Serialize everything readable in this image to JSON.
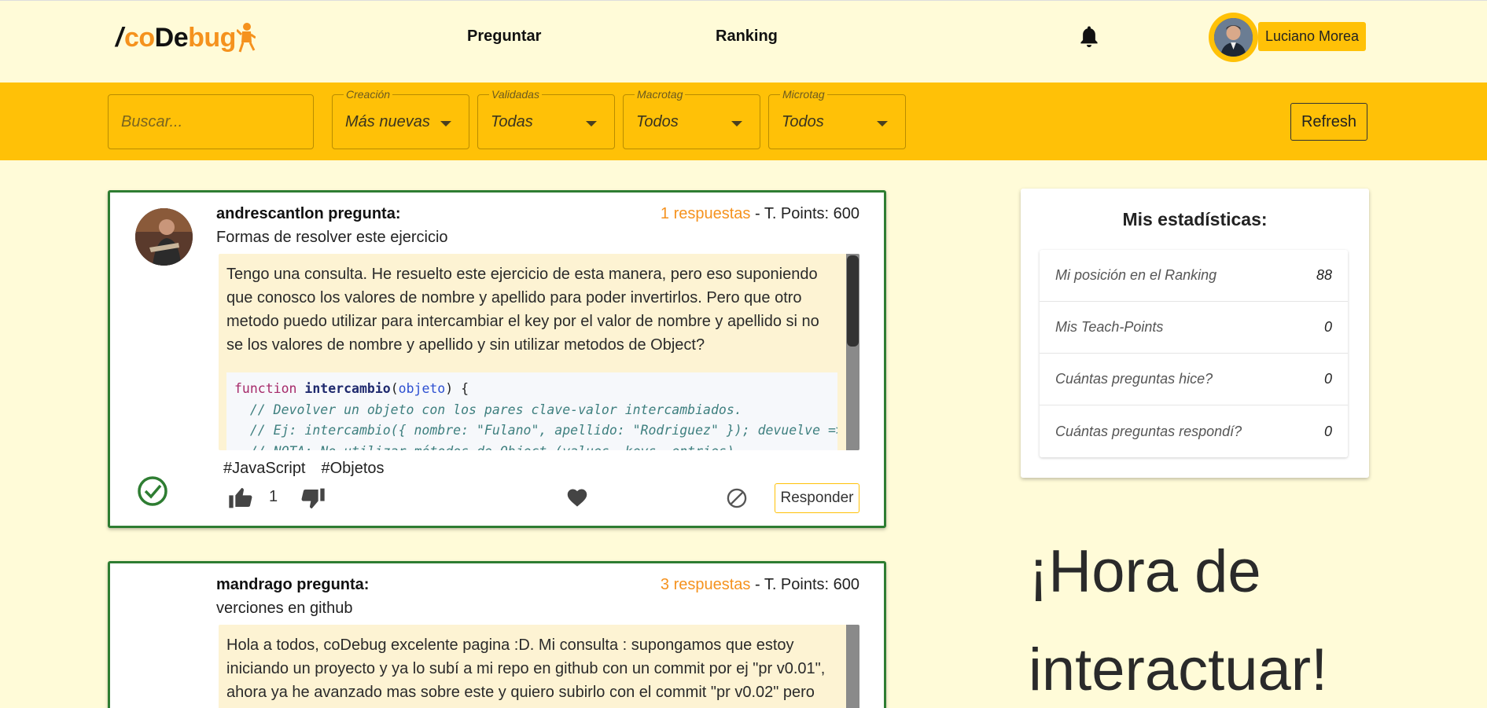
{
  "brand": {
    "slash": "/",
    "co": "co",
    "de": "De",
    "bug": "bug"
  },
  "nav": {
    "preguntar": "Preguntar",
    "ranking": "Ranking"
  },
  "user": {
    "name": "Luciano Morea"
  },
  "filters": {
    "search_placeholder": "Buscar...",
    "selects": [
      {
        "label": "Creación",
        "value": "Más nuevas"
      },
      {
        "label": "Validadas",
        "value": "Todas"
      },
      {
        "label": "Macrotag",
        "value": "Todos"
      },
      {
        "label": "Microtag",
        "value": "Todos"
      }
    ],
    "refresh": "Refresh"
  },
  "questions": [
    {
      "author": "andrescantlon pregunta:",
      "title": "Formas de resolver este ejercicio",
      "answers": "1 respuestas",
      "points": " - T. Points: 600",
      "body": "Tengo una consulta. He resuelto este ejercicio de esta manera, pero eso suponiendo que conosco los valores de nombre y apellido para poder invertirlos. Pero que otro metodo puedo utilizar para intercambiar el key por el valor de nombre y apellido si no se los valores de nombre y apellido y sin utilizar metodos de Object?",
      "code": {
        "kw": "function",
        "fn": "intercambio",
        "param": "objeto",
        "comment1": "  // Devolver un objeto con los pares clave-valor intercambiados.",
        "comment2": "  // Ej: intercambio({ nombre: \"Fulano\", apellido: \"Rodriguez\" }); devuelve => {",
        "comment3": "  // NOTA: No utilizar métodos de Object (values, keys, entries)."
      },
      "tags": [
        "#JavaScript",
        "#Objetos"
      ],
      "likes": "1",
      "respond": "Responder"
    },
    {
      "author": "mandrago pregunta:",
      "title": "verciones en github",
      "answers": "3 respuestas",
      "points": " - T. Points: 600",
      "body": "Hola a todos, coDebug excelente pagina :D. Mi consulta : supongamos que estoy iniciando un proyecto y ya lo subí a mi repo en github con un commit por ej \"pr v0.01\", ahora ya he avanzado mas sobre este y quiero subirlo con el commit \"pr v0.02\" pero sin"
    }
  ],
  "stats": {
    "title": "Mis estadísticas:",
    "rows": [
      {
        "label": "Mi posición en el Ranking",
        "value": "88"
      },
      {
        "label": "Mis Teach-Points",
        "value": "0"
      },
      {
        "label": "Cuántas preguntas hice?",
        "value": "0"
      },
      {
        "label": "Cuántas preguntas respondí?",
        "value": "0"
      }
    ]
  },
  "banner": "¡Hora de interactuar!",
  "colors": {
    "accent": "#ffc107",
    "orange": "#f5921e",
    "green": "#2e7d32",
    "bg": "#fffbd8"
  }
}
